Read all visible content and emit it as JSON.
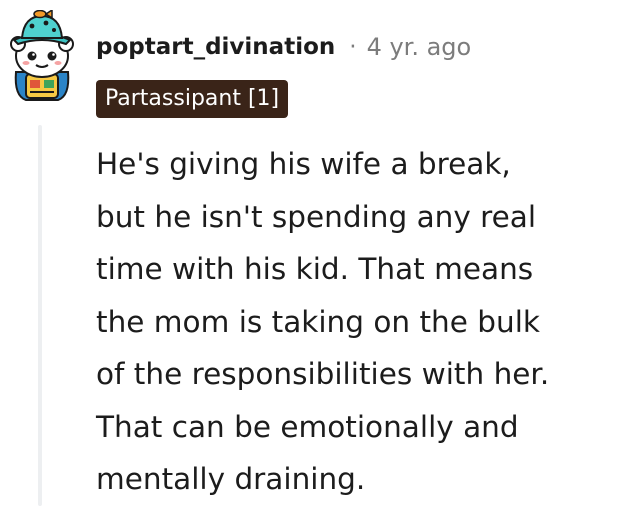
{
  "comment": {
    "username": "poptart_divination",
    "separator": "·",
    "timestamp": "4 yr. ago",
    "flair": "Partassipant [1]",
    "body_lines": [
      "He's giving his wife a break,",
      "but he isn't spending any real",
      "time with his kid. That means",
      "the mom is taking on the bulk",
      "of the responsibilities with her.",
      "That can be emotionally and",
      "mentally draining."
    ]
  },
  "colors": {
    "flair_background": "#3a2418",
    "flair_text": "#ffffff",
    "username": "#1c1c1c",
    "meta": "#7c7c7c",
    "body_text": "#1c1c1c",
    "thread_line": "#edeff1"
  },
  "icons": {
    "avatar": "snoo-avatar-with-hat-icon"
  }
}
